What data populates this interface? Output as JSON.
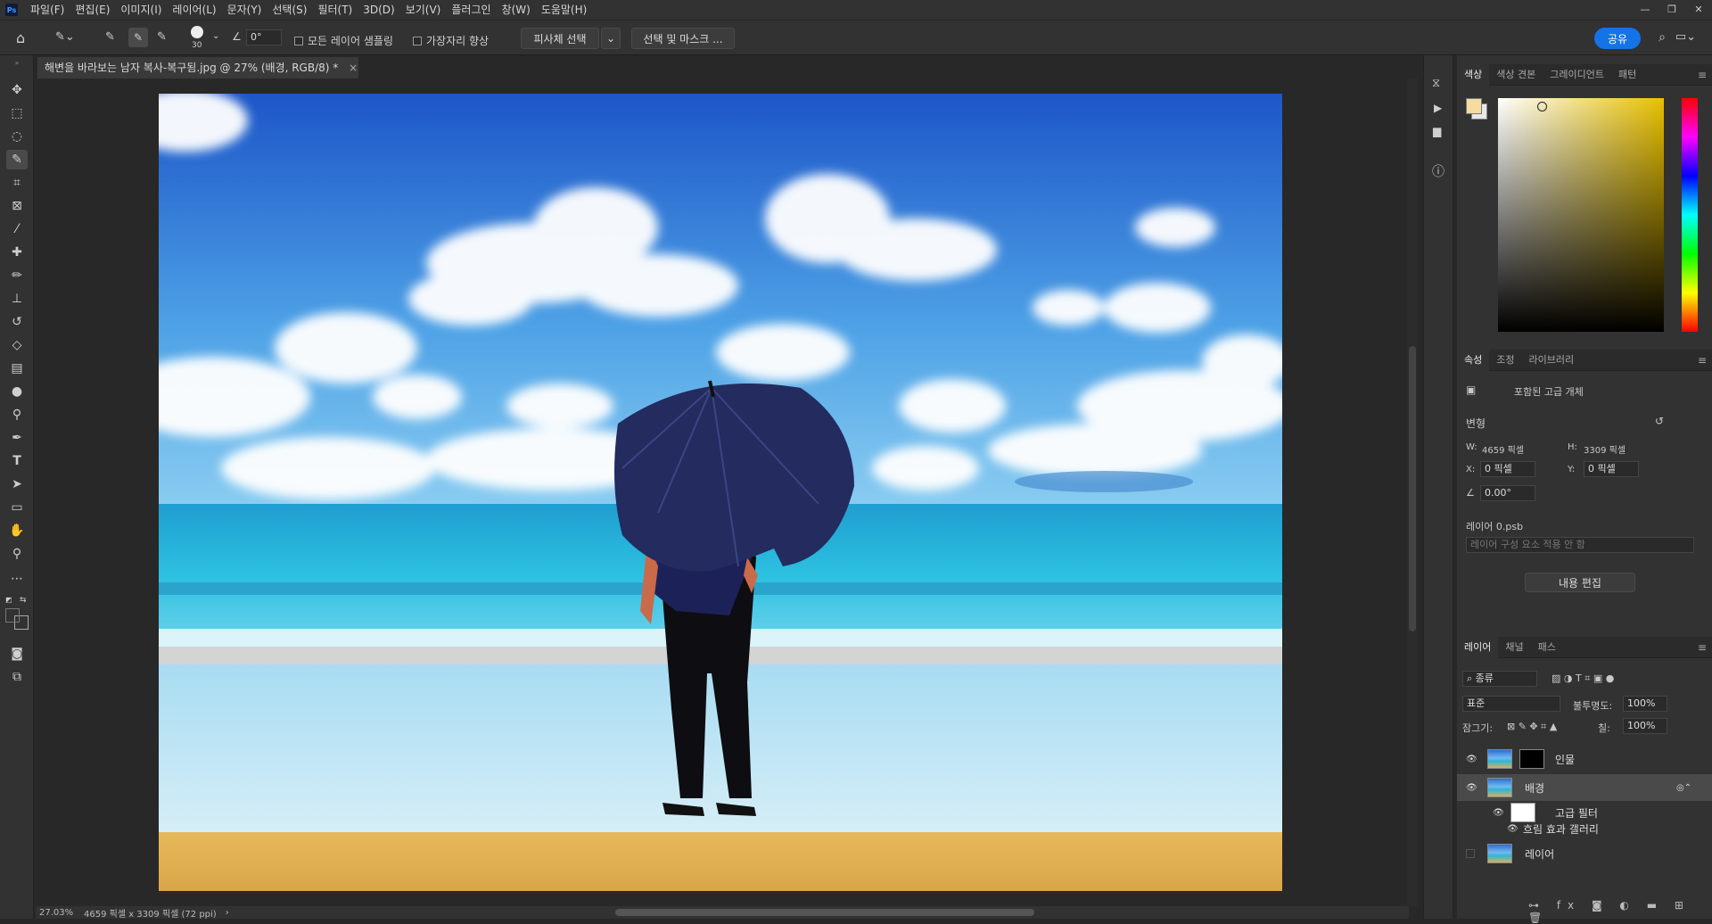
{
  "app": {
    "logo": "Ps"
  },
  "menu": [
    "파일(F)",
    "편집(E)",
    "이미지(I)",
    "레이어(L)",
    "문자(Y)",
    "선택(S)",
    "필터(T)",
    "3D(D)",
    "보기(V)",
    "플러그인",
    "창(W)",
    "도움말(H)"
  ],
  "window_controls": [
    "—",
    "❐",
    "✕"
  ],
  "options": {
    "brush_size": "30",
    "angle": "0°",
    "sample_all": "모든 레이어 샘플링",
    "enhance_edge": "가장자리 향상",
    "select_subject": "피사체 선택",
    "select_mask": "선택 및 마스크 ...",
    "share": "공유"
  },
  "document": {
    "tab_title": "해변을 바라보는 남자 복사-복구됨.jpg @ 27% (배경, RGB/8) *",
    "close": "×"
  },
  "status": {
    "zoom": "27.03%",
    "dimensions": "4659 픽셀 x 3309 픽셀 (72 ppi)"
  },
  "color_panel": {
    "tabs": [
      "색상",
      "색상 견본",
      "그레이디언트",
      "패턴"
    ],
    "foreground": "#f5dca0",
    "background": "#e8e8e8",
    "hue_color": "#e8c000"
  },
  "properties": {
    "tabs": [
      "속성",
      "조정",
      "라이브러리"
    ],
    "type": "포함된 고급 개체",
    "section": "변형",
    "w_label": "W:",
    "w": "4659 픽셀",
    "h_label": "H:",
    "h": "3309 픽셀",
    "x_label": "X:",
    "x": "0 픽셀",
    "y_label": "Y:",
    "y": "0 픽셀",
    "angle": "0.00°",
    "file": "레이어 0.psb",
    "comp": "레이어 구성 요소 적용 안 함",
    "edit_btn": "내용 편집"
  },
  "layers_panel": {
    "tabs": [
      "레이어",
      "채널",
      "패스"
    ],
    "filter": "종류",
    "blend": "표준",
    "opacity_label": "불투명도:",
    "opacity": "100%",
    "lock_label": "잠그기:",
    "fill_label": "칠:",
    "fill": "100%",
    "layers": [
      {
        "name": "인물"
      },
      {
        "name": "배경"
      },
      {
        "name": "고급 필터"
      },
      {
        "name": "흐림 효과 갤러리"
      },
      {
        "name": "레이어"
      }
    ]
  }
}
